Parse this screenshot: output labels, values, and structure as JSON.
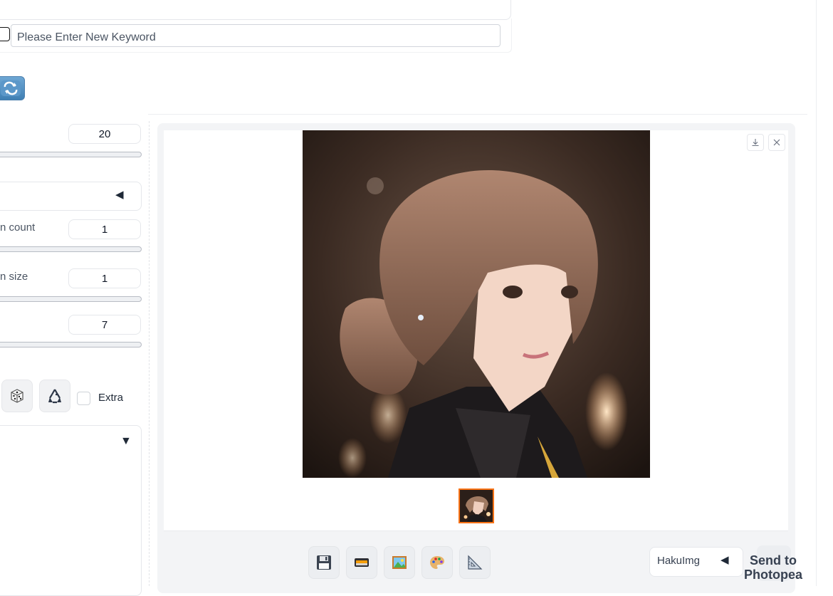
{
  "keyword": {
    "placeholder": "Please Enter New Keyword",
    "value": ""
  },
  "settings": {
    "steps": {
      "value": "20",
      "fraction": 0.0
    },
    "batch_count": {
      "label_visible": "n count",
      "value": "1",
      "fraction": 0.0
    },
    "batch_size": {
      "label_visible": "n size",
      "value": "1",
      "fraction": 0.0
    },
    "cfg": {
      "value": "7",
      "fraction": 0.0
    },
    "accordion_arrow": "◀",
    "extra_label": "Extra",
    "lower_arrow": "▼"
  },
  "output": {
    "toolbar_buttons": [
      "save-icon",
      "zip-icon",
      "image-icon",
      "palette-icon",
      "ruler-icon"
    ],
    "dropdown_value": "HakuImg",
    "dropdown_arrow": "◀",
    "send_to_label": "Send to Photopea"
  },
  "colors": {
    "accent": "#f97316",
    "refresh_button": "#4f8dc2",
    "panel_bg": "#f3f4f6"
  }
}
